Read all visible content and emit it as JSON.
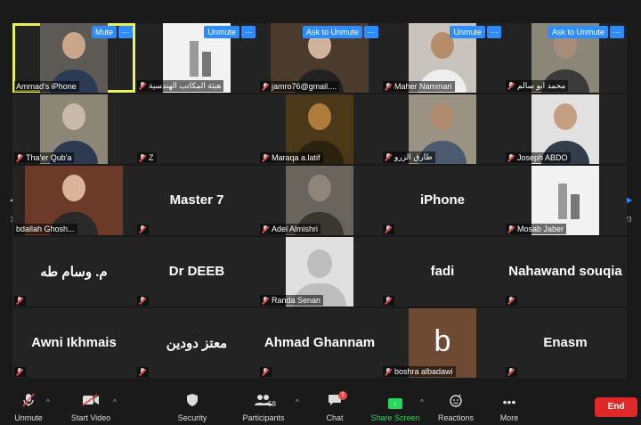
{
  "pager": {
    "page_left": "1/3",
    "page_right": "1/3"
  },
  "tiles": [
    {
      "name": "Ammad's iPhone",
      "buttons": [
        "Mute"
      ],
      "accent": "#e8f05a"
    },
    {
      "name": "هيئة المكاتب الهندسية",
      "buttons": [
        "Unmute"
      ]
    },
    {
      "name": "jamro76@gmail....",
      "buttons": [
        "Ask to Unmute"
      ]
    },
    {
      "name": "Maher Nammari",
      "buttons": [
        "Unmute"
      ]
    },
    {
      "name": "محمد ابو سالم",
      "buttons": [
        "Ask to Unmute"
      ]
    },
    {
      "name": "Tha'er Qub'a"
    },
    {
      "name": "Z"
    },
    {
      "name": "Maraqa a.latif"
    },
    {
      "name": "طارق الزرو"
    },
    {
      "name": "Joseph ABDO"
    },
    {
      "name": "bdallah Ghosh..."
    },
    {
      "big": "Master 7"
    },
    {
      "name": "Adel Almishri"
    },
    {
      "big": "iPhone"
    },
    {
      "name": "Mosab Jaber"
    },
    {
      "big": "م. وسام طه"
    },
    {
      "big": "Dr DEEB"
    },
    {
      "name": "Randa Senan"
    },
    {
      "big": "fadi"
    },
    {
      "big": "Nahawand souqia"
    },
    {
      "big": "Awni Ikhmais"
    },
    {
      "big": "معتز دودين"
    },
    {
      "big": "Ahmad Ghannam"
    },
    {
      "name": "boshra albadawi",
      "letter": "b"
    },
    {
      "big": "Enasm"
    }
  ],
  "more_label": "···",
  "toolbar": {
    "unmute": "Unmute",
    "start_video": "Start Video",
    "security": "Security",
    "participants": "Participants",
    "participants_count": "58",
    "chat": "Chat",
    "chat_badge": "1",
    "share_screen": "Share Screen",
    "reactions": "Reactions",
    "more": "More",
    "end": "End"
  },
  "colors": {
    "button_blue": "#2d8cff",
    "share_green": "#23d959",
    "end_red": "#e02828",
    "active_speaker": "#e8f05a"
  },
  "icons": [
    "mic-muted-icon",
    "video-off-icon",
    "shield-icon",
    "participants-icon",
    "chat-icon",
    "share-screen-icon",
    "reactions-icon",
    "more-icon"
  ]
}
